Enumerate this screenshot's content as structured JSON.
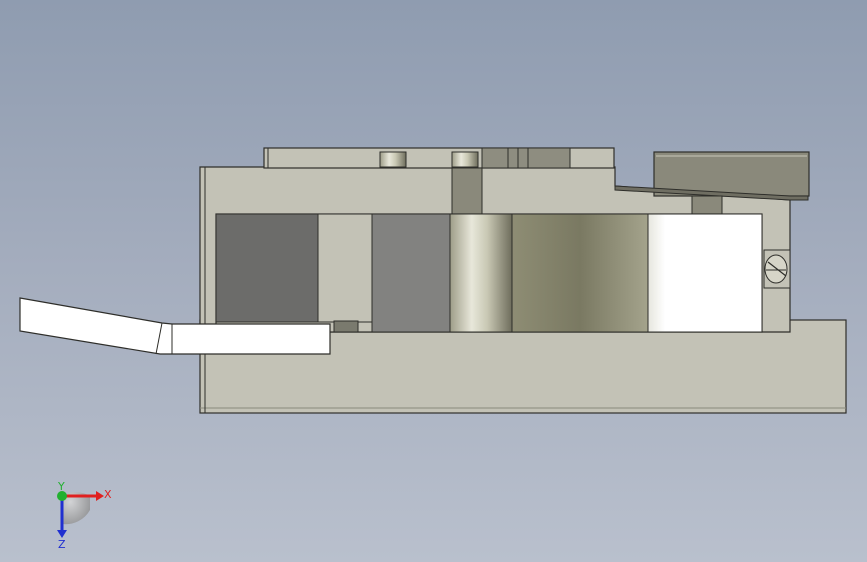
{
  "scene": {
    "background_top": "#8f9cb0",
    "background_bottom": "#b9c0cd",
    "part_body_color": "#c3c2b6",
    "part_edge_color": "#2e2e2a",
    "highlight_color": "#ffffff"
  },
  "triad": {
    "x_label": "X",
    "y_label": "Y",
    "z_label": "Z",
    "x_color": "#e02020",
    "y_color": "#22b030",
    "z_color": "#2030d0"
  }
}
